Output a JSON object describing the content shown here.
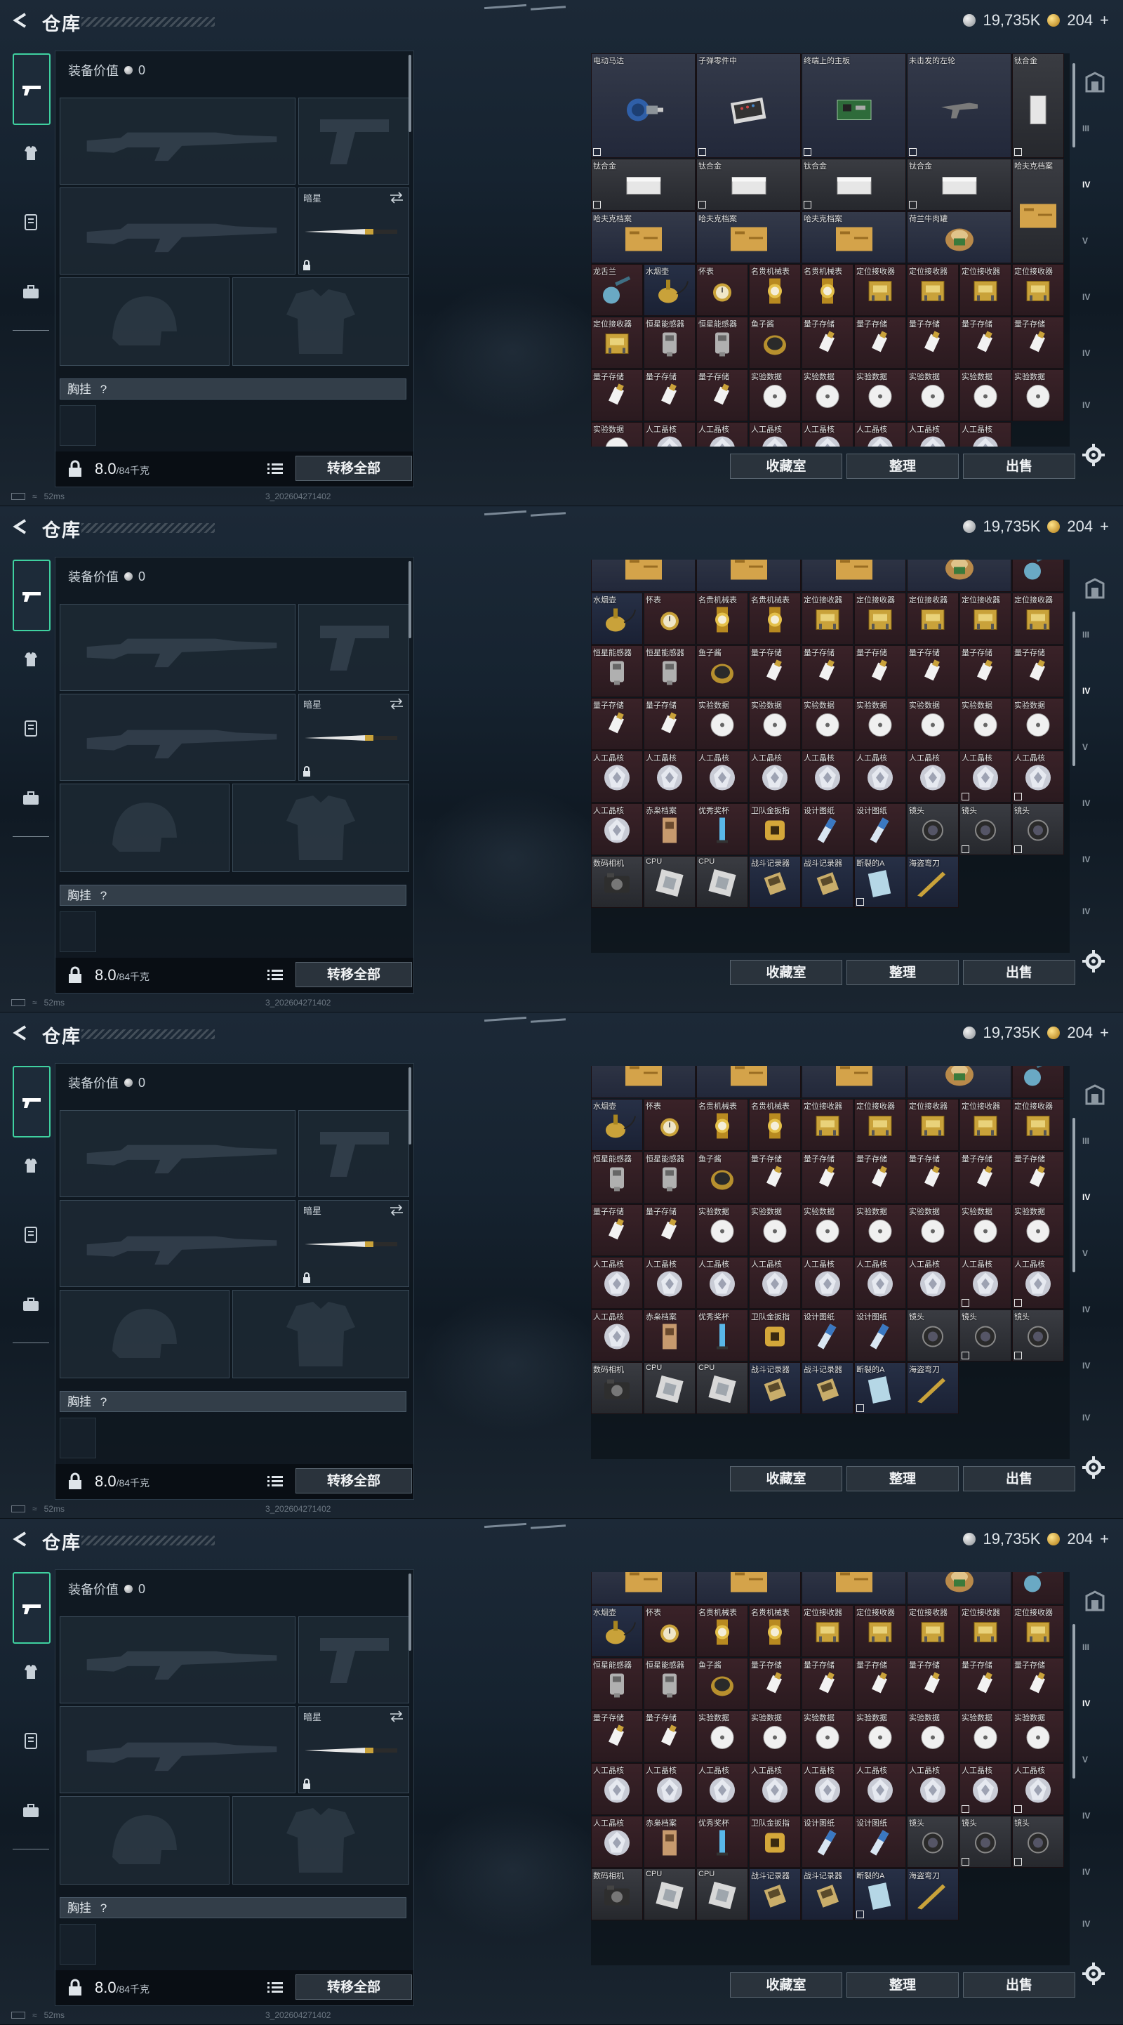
{
  "header": {
    "title": "仓库",
    "silver": "19,735K",
    "gold": "204",
    "gold_plus": "+"
  },
  "loadout": {
    "equip_value_label": "装备价值",
    "equip_value": "0",
    "knife_label": "暗星",
    "chest_label": "胸挂",
    "chest_q": "?",
    "weight": "8.0",
    "weight_max": "/84千克",
    "transfer_all": "转移全部"
  },
  "footer": {
    "collection": "收藏室",
    "sort": "整理",
    "sell": "出售"
  },
  "status": {
    "ping": "52ms",
    "build": "3_202604271402"
  },
  "colors": {
    "accent": "#3fd1a0",
    "gold": "#e2b23a",
    "cell_red": "#3a2228"
  },
  "inventory": {
    "top_big": [
      "电动马达",
      "子弹零件中",
      "终端上的主板",
      "未击发的左轮",
      "钛合金"
    ],
    "ti_row": [
      "钛合金",
      "钛合金"
    ],
    "ti_row2": [
      "钛合金",
      "钛合金",
      "钛合金",
      "钛合金",
      "哈夫克档案"
    ],
    "haf_row": [
      "哈夫克档案",
      "哈夫克档案",
      "哈夫克档案",
      "荷兰牛肉罐"
    ],
    "r1": [
      "龙舌兰",
      "水烟壶",
      "怀表",
      "名贵机械表",
      "名贵机械表",
      "定位接收器",
      "定位接收器"
    ],
    "r2": [
      "定位接收器",
      "定位接收器",
      "恒星能感器",
      "恒星能感器",
      "鱼子酱",
      "量子存储",
      "量子存储",
      "量子存储",
      "量子存储"
    ],
    "r3": [
      "量子存储",
      "量子存储",
      "量子存储",
      "量子存储",
      "实验数据",
      "实验数据",
      "实验数据",
      "实验数据",
      "实验数据"
    ],
    "r4": [
      "实验数据",
      "实验数据",
      "人工晶核",
      "人工晶核",
      "人工晶核",
      "人工晶核",
      "人工晶核",
      "人工晶核",
      "人工晶核"
    ],
    "r5": [
      "人工晶核",
      "人工晶核",
      "人工晶核",
      "赤枭档案",
      "优秀奖杯",
      "卫队金扳指",
      "设计图纸",
      "设计图纸",
      "镜头"
    ],
    "r6": [
      "镜头",
      "镜头",
      "数码相机",
      "CPU",
      "CPU",
      "战斗记录器",
      "战斗记录器",
      "断裂的A",
      "海盗弯刀"
    ]
  }
}
